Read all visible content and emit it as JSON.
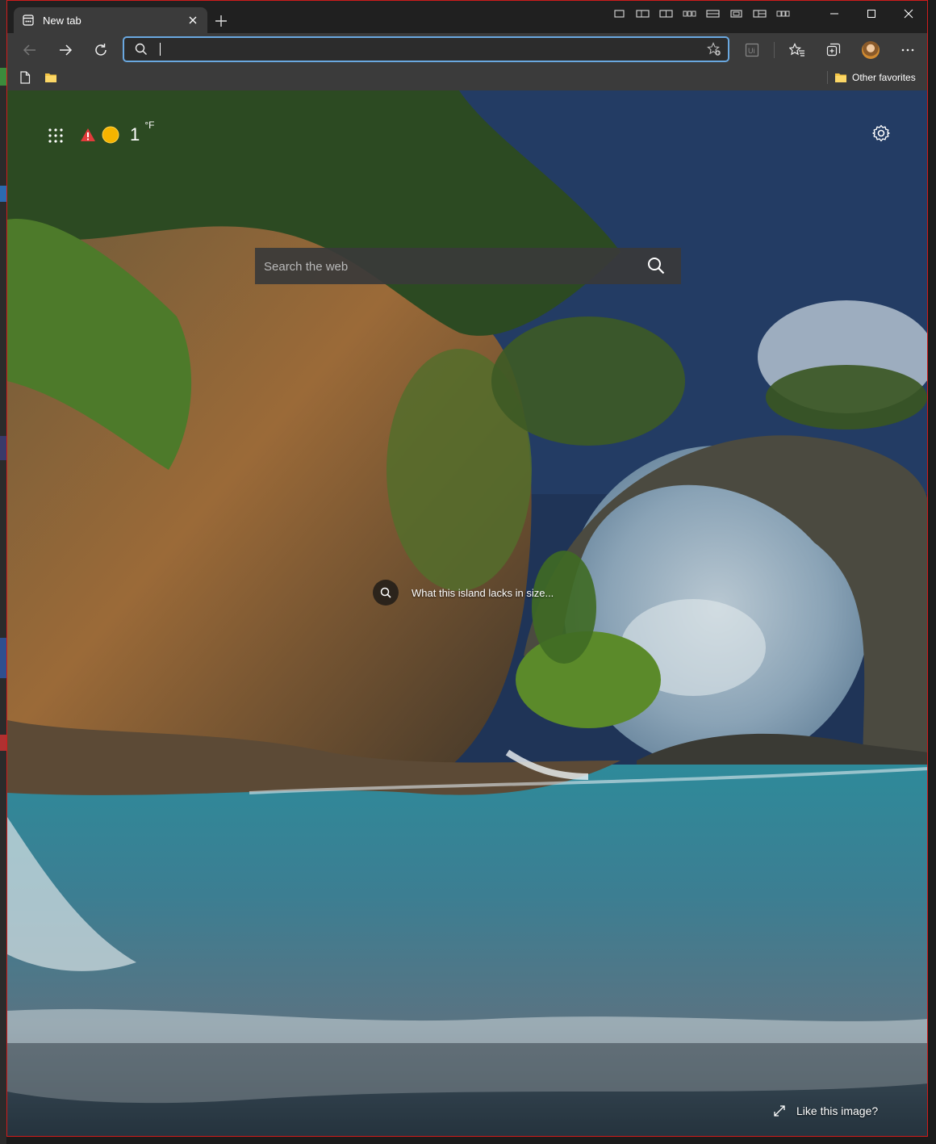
{
  "window": {
    "tab_title": "New tab",
    "controls": [
      "minimize-icon",
      "maximize-icon",
      "close-icon"
    ]
  },
  "toolbar": {
    "address_value": "",
    "icons": [
      "back-icon",
      "forward-icon",
      "refresh-icon",
      "search-icon",
      "add-favorite-icon",
      "extension-icon",
      "favorites-icon",
      "collections-icon",
      "profile-avatar",
      "more-icon"
    ]
  },
  "bookmarks": {
    "other_favorites": "Other favorites"
  },
  "newtab": {
    "weather_temp": "1",
    "weather_unit": "°F",
    "search_placeholder": "Search the web",
    "image_caption": "What this island lacks in size...",
    "like_image": "Like this image?"
  },
  "colors": {
    "accent_border": "#6aa8e0",
    "frame_border": "#d01c1c",
    "toolbar_bg": "#3b3b3b",
    "titlebar_bg": "#202020"
  }
}
